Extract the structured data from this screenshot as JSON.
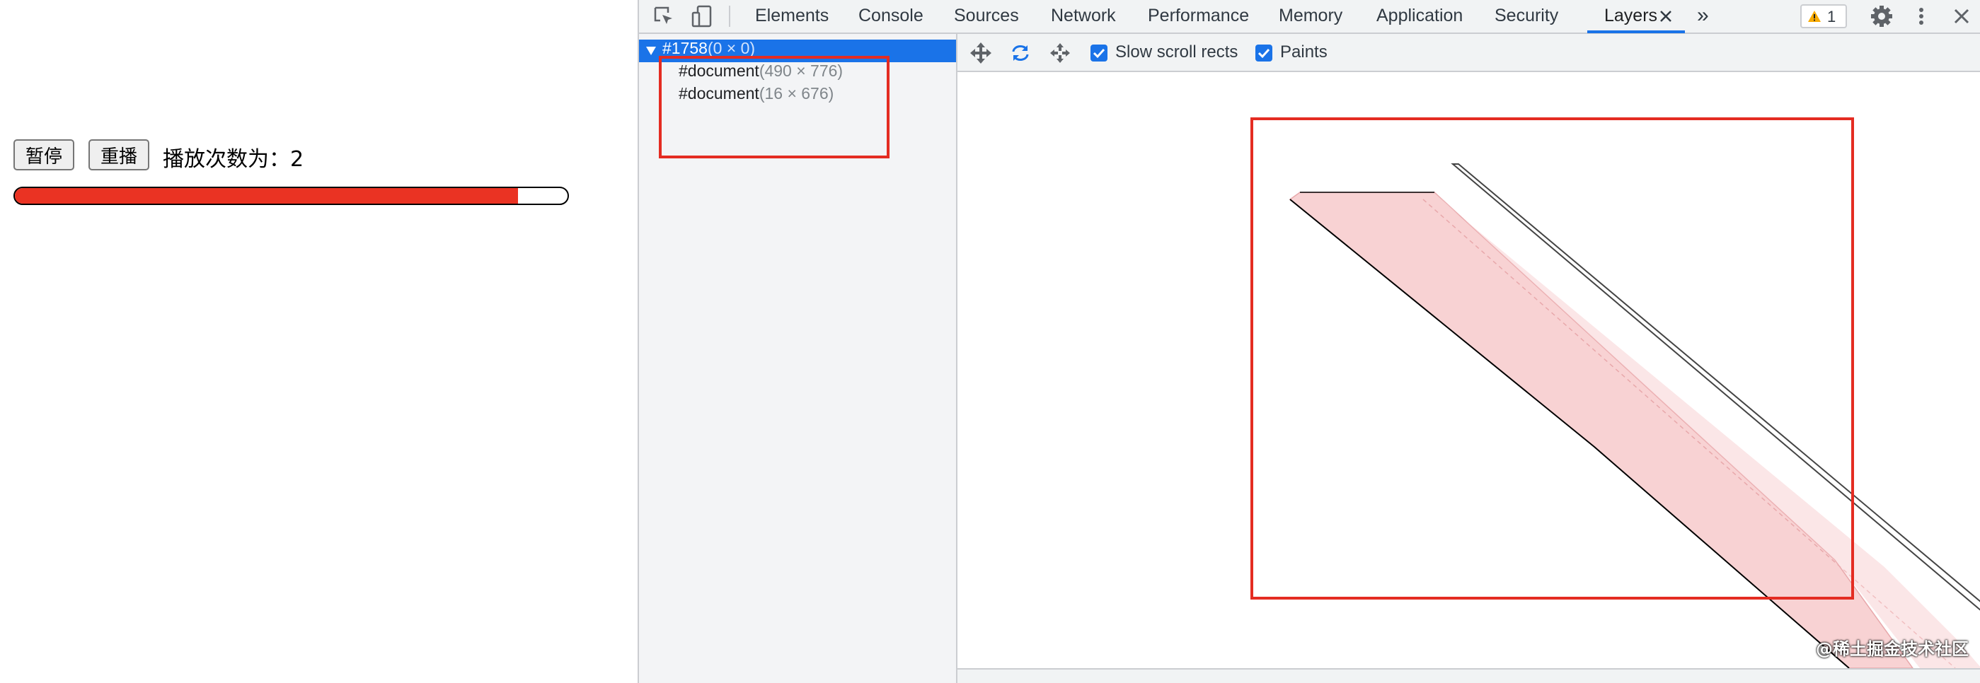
{
  "page": {
    "pause_label": "暂停",
    "replay_label": "重播",
    "play_count_text": "播放次数为：2",
    "progress_percent": 91
  },
  "devtools": {
    "tabs": [
      "Elements",
      "Console",
      "Sources",
      "Network",
      "Performance",
      "Memory",
      "Application",
      "Security",
      "Layers"
    ],
    "active_tab": "Layers",
    "more_tabs_glyph": "»",
    "warning_count": "1",
    "icons": [
      "inspect-element-icon",
      "device-toolbar-icon",
      "close-tab-icon",
      "more-tabs-icon",
      "warning-icon",
      "settings-gear-icon",
      "kebab-menu-icon",
      "close-devtools-icon",
      "pan-mode-icon",
      "rotate-mode-icon",
      "reset-transform-icon"
    ],
    "tree": [
      {
        "name": "#1758",
        "size": "(0 × 0)"
      },
      {
        "name": "#document",
        "size": "(490 × 776)"
      },
      {
        "name": "#document",
        "size": "(16 × 676)"
      }
    ],
    "toolbar": {
      "slow_scroll_rects_label": "Slow scroll rects",
      "paints_label": "Paints",
      "slow_scroll_rects_checked": true,
      "paints_checked": true
    }
  },
  "watermark": "@稀土掘金技术社区",
  "colors": {
    "progress_fill": "#ea3323",
    "highlight_box": "#e42c22",
    "devtools_accent": "#1a73e8",
    "layer_fill": "#f8d2d3"
  }
}
